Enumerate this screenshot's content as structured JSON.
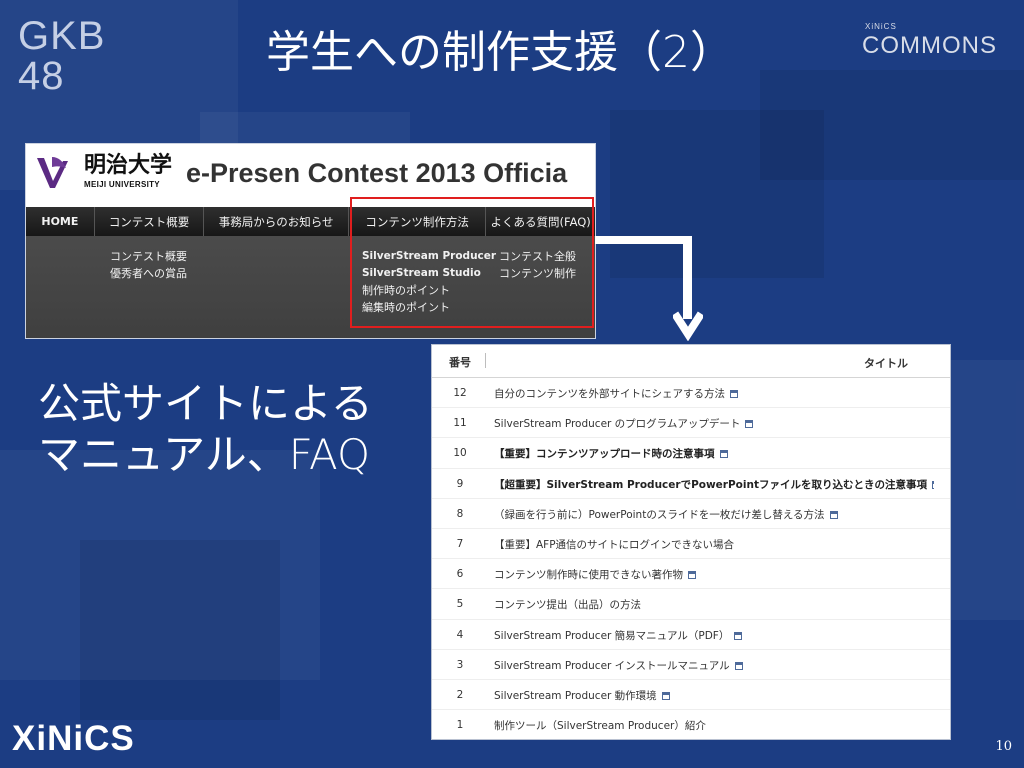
{
  "brand": {
    "gkb_lines": [
      "GKB",
      "48"
    ],
    "commons_small": "XiNiCS",
    "commons_big": "COMMONS",
    "footer_logo": "XiNiCS",
    "page_number": "10"
  },
  "slide": {
    "title": "学生への制作支援（2）",
    "left_text": "公式サイトによる\nマニュアル、FAQ"
  },
  "website": {
    "university_name": "明治大学",
    "university_sub": "MEIJI UNIVERSITY",
    "site_title": "e-Presen Contest 2013 Officia",
    "nav": {
      "home": "HOME",
      "contest": "コンテスト概要",
      "news": "事務局からのお知らせ",
      "production": "コンテンツ制作方法",
      "faq": "よくある質問(FAQ)"
    },
    "dropdown": {
      "col1": [
        "コンテスト概要",
        "優秀者への賞品"
      ],
      "col2": [
        "SilverStream Producer",
        "SilverStream Studio",
        "制作時のポイント",
        "編集時のポイント"
      ],
      "col3": [
        "コンテスト全般",
        "コンテンツ制作"
      ]
    },
    "colors": {
      "outline_highlight": "#e01e1e",
      "nav_bar": "#202020",
      "dropdown": "#454545"
    }
  },
  "table": {
    "headers": {
      "number": "番号",
      "title": "タイトル"
    },
    "rows": [
      {
        "number": "12",
        "title": "自分のコンテンツを外部サイトにシェアする方法"
      },
      {
        "number": "11",
        "title": "SilverStream Producer のプログラムアップデート"
      },
      {
        "number": "10",
        "title": "【重要】コンテンツアップロード時の注意事項"
      },
      {
        "number": "9",
        "title": "【超重要】SilverStream ProducerでPowerPointファイルを取り込むときの注意事項"
      },
      {
        "number": "8",
        "title": "（録画を行う前に）PowerPointのスライドを一枚だけ差し替える方法"
      },
      {
        "number": "7",
        "title": "【重要】AFP通信のサイトにログインできない場合"
      },
      {
        "number": "6",
        "title": "コンテンツ制作時に使用できない著作物"
      },
      {
        "number": "5",
        "title": "コンテンツ提出（出品）の方法"
      },
      {
        "number": "4",
        "title": "SilverStream Producer 簡易マニュアル（PDF）"
      },
      {
        "number": "3",
        "title": "SilverStream Producer インストールマニュアル"
      },
      {
        "number": "2",
        "title": "SilverStream Producer 動作環境"
      },
      {
        "number": "1",
        "title": "制作ツール（SilverStream Producer）紹介"
      }
    ]
  },
  "icons": {
    "document": "document-icon",
    "arrow": "down-arrow-icon",
    "meiji": "meiji-logo-icon"
  }
}
